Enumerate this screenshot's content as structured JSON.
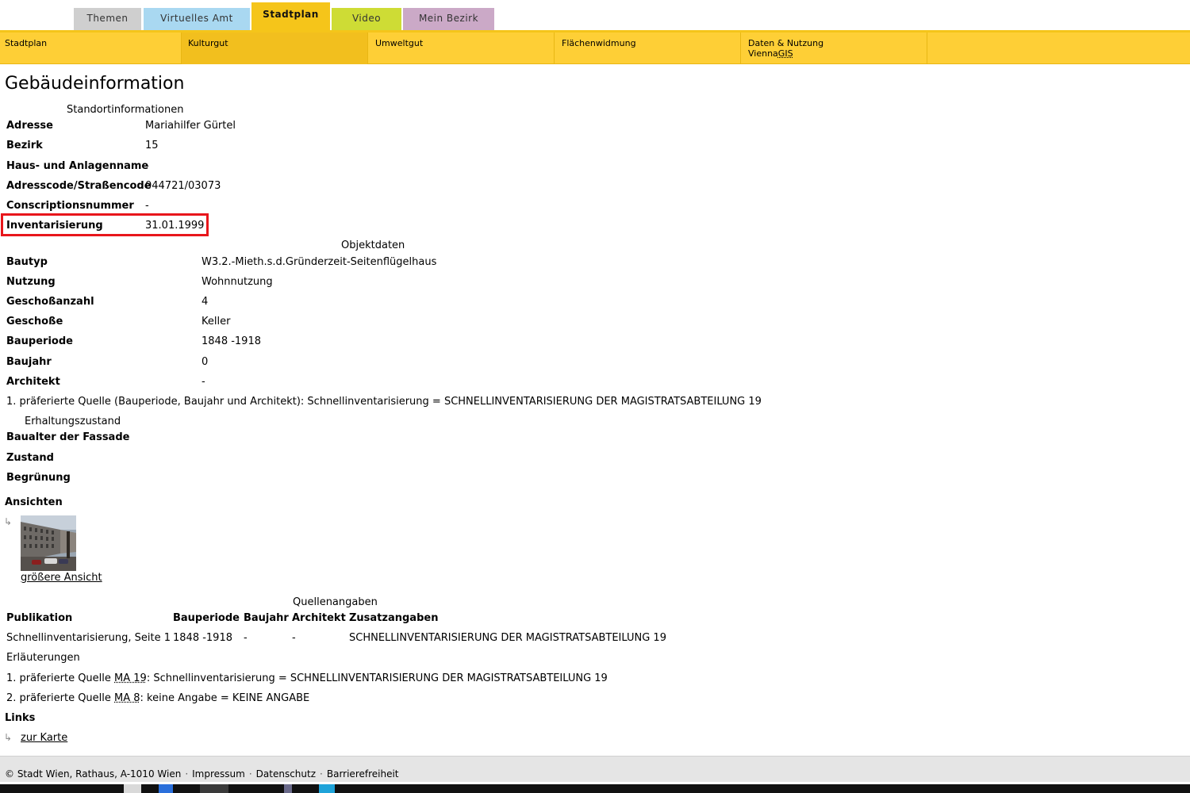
{
  "top_tabs": [
    {
      "label": "Themen",
      "color": "#cfcfcf"
    },
    {
      "label": "Virtuelles Amt",
      "color": "#a9d8f1"
    },
    {
      "label": "Stadtplan",
      "color": "#f5c51a",
      "active": true
    },
    {
      "label": "Video",
      "color": "#cedc35"
    },
    {
      "label": "Mein Bezirk",
      "color": "#cba9c7"
    }
  ],
  "subnav": {
    "items": [
      "Stadtplan",
      "Kulturgut",
      "Umweltgut",
      "Flächenwidmung"
    ],
    "last_line1": "Daten & Nutzung",
    "last_line2_prefix": "Vienna",
    "last_line2_abbr": "GIS"
  },
  "page_title": "Gebäudeinformation",
  "standort": {
    "caption": "Standortinformationen",
    "rows": [
      {
        "label": "Adresse",
        "value": "Mariahilfer Gürtel"
      },
      {
        "label": "Bezirk",
        "value": "15"
      },
      {
        "label": "Haus- und Anlagenname",
        "value": "-"
      },
      {
        "label": "Adresscode/Straßencode",
        "value": "044721/03073"
      },
      {
        "label": "Conscriptionsnummer",
        "value": "-"
      },
      {
        "label": "Inventarisierung",
        "value": "31.01.1999"
      }
    ]
  },
  "objektdaten": {
    "caption": "Objektdaten",
    "rows": [
      {
        "label": "Bautyp",
        "value": "W3.2.-Mieth.s.d.Gründerzeit-Seitenflügelhaus"
      },
      {
        "label": "Nutzung",
        "value": "Wohnnutzung"
      },
      {
        "label": "Geschoßanzahl",
        "value": "4"
      },
      {
        "label": "Geschoße",
        "value": "Keller"
      },
      {
        "label": "Bauperiode",
        "value": "1848 -1918"
      },
      {
        "label": "Baujahr",
        "value": "0"
      },
      {
        "label": "Architekt",
        "value": "-"
      }
    ],
    "footnote": "1. präferierte Quelle (Bauperiode, Baujahr und Architekt): Schnellinventarisierung = SCHNELLINVENTARISIERUNG DER MAGISTRATSABTEILUNG 19"
  },
  "erhaltung": {
    "caption": "Erhaltungszustand",
    "rows": [
      {
        "label": "Baualter der Fassade",
        "value": "-"
      },
      {
        "label": "Zustand",
        "value": ""
      },
      {
        "label": "Begrünung",
        "value": ""
      }
    ]
  },
  "ansichten": {
    "heading": "Ansichten",
    "link": "größere Ansicht"
  },
  "quellen": {
    "caption": "Quellenangaben",
    "headers": [
      "Publikation",
      "Bauperiode",
      "Baujahr",
      "Architekt",
      "Zusatzangaben"
    ],
    "row": [
      "Schnellinventarisierung, Seite 1",
      "1848 -1918",
      "-",
      "-",
      "SCHNELLINVENTARISIERUNG DER MAGISTRATSABTEILUNG 19"
    ]
  },
  "erlaeuterungen": {
    "heading": "Erläuterungen",
    "line1_prefix": "1. präferierte Quelle ",
    "line1_abbr": "MA 19",
    "line1_suffix": ": Schnellinventarisierung = SCHNELLINVENTARISIERUNG DER MAGISTRATSABTEILUNG 19",
    "line2_prefix": "2. präferierte Quelle ",
    "line2_abbr": "MA 8",
    "line2_suffix": ": keine Angabe = KEINE ANGABE"
  },
  "links": {
    "heading": "Links",
    "karte": "zur Karte"
  },
  "footer": {
    "copyright": "© Stadt Wien, Rathaus, A-1010 Wien",
    "impressum": "Impressum",
    "datenschutz": "Datenschutz",
    "barrierefreiheit": "Barrierefreiheit"
  },
  "arrow_glyph": "↳",
  "accent_color": "#f5c51a",
  "highlight_color": "#e8161b"
}
